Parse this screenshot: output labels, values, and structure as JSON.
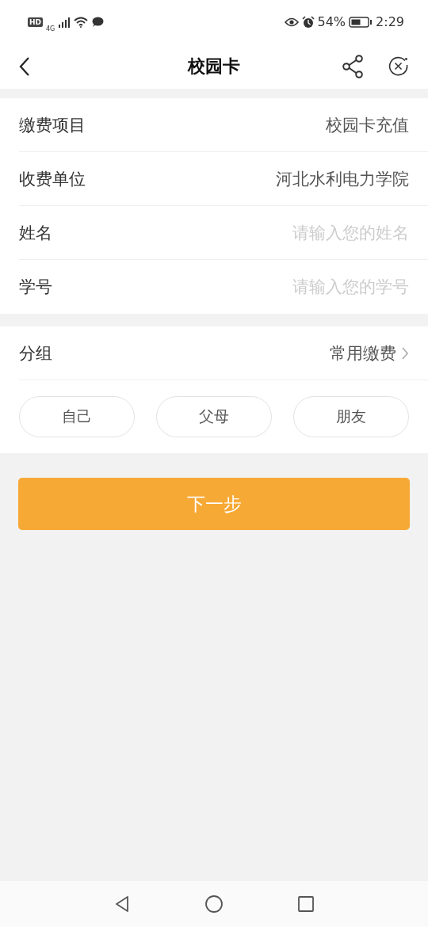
{
  "status_bar": {
    "hd": "HD",
    "network": "4G",
    "battery": "54%",
    "time": "2:29"
  },
  "nav": {
    "title": "校园卡"
  },
  "fields": [
    {
      "label": "缴费项目",
      "kind": "value",
      "value": "校园卡充值"
    },
    {
      "label": "收费单位",
      "kind": "value",
      "value": "河北水利电力学院"
    },
    {
      "label": "姓名",
      "kind": "input",
      "placeholder": "请输入您的姓名"
    },
    {
      "label": "学号",
      "kind": "input",
      "placeholder": "请输入您的学号"
    }
  ],
  "group": {
    "label": "分组",
    "value": "常用缴费",
    "chips": [
      {
        "label": "自己",
        "selected": false
      },
      {
        "label": "父母",
        "selected": false
      },
      {
        "label": "朋友",
        "selected": false
      }
    ]
  },
  "next_button": "下一步"
}
